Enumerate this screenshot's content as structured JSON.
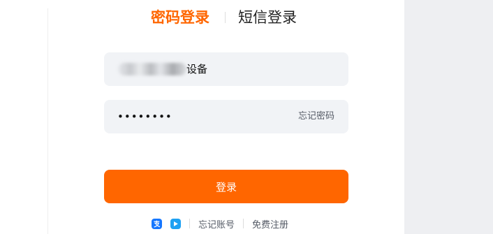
{
  "tabs": {
    "password_login": "密码登录",
    "sms_login": "短信登录"
  },
  "account": {
    "visible_suffix": "设备"
  },
  "password": {
    "masked_value": "••••••••",
    "forgot_password": "忘记密码"
  },
  "login_button": "登录",
  "footer": {
    "alipay_icon": "alipay-icon",
    "tmall_icon": "tmall-app-icon",
    "forgot_account": "忘记账号",
    "free_register": "免费注册"
  },
  "colors": {
    "accent": "#ff6600",
    "input_background": "#f1f3f6",
    "side_panel": "#eeeff2"
  }
}
